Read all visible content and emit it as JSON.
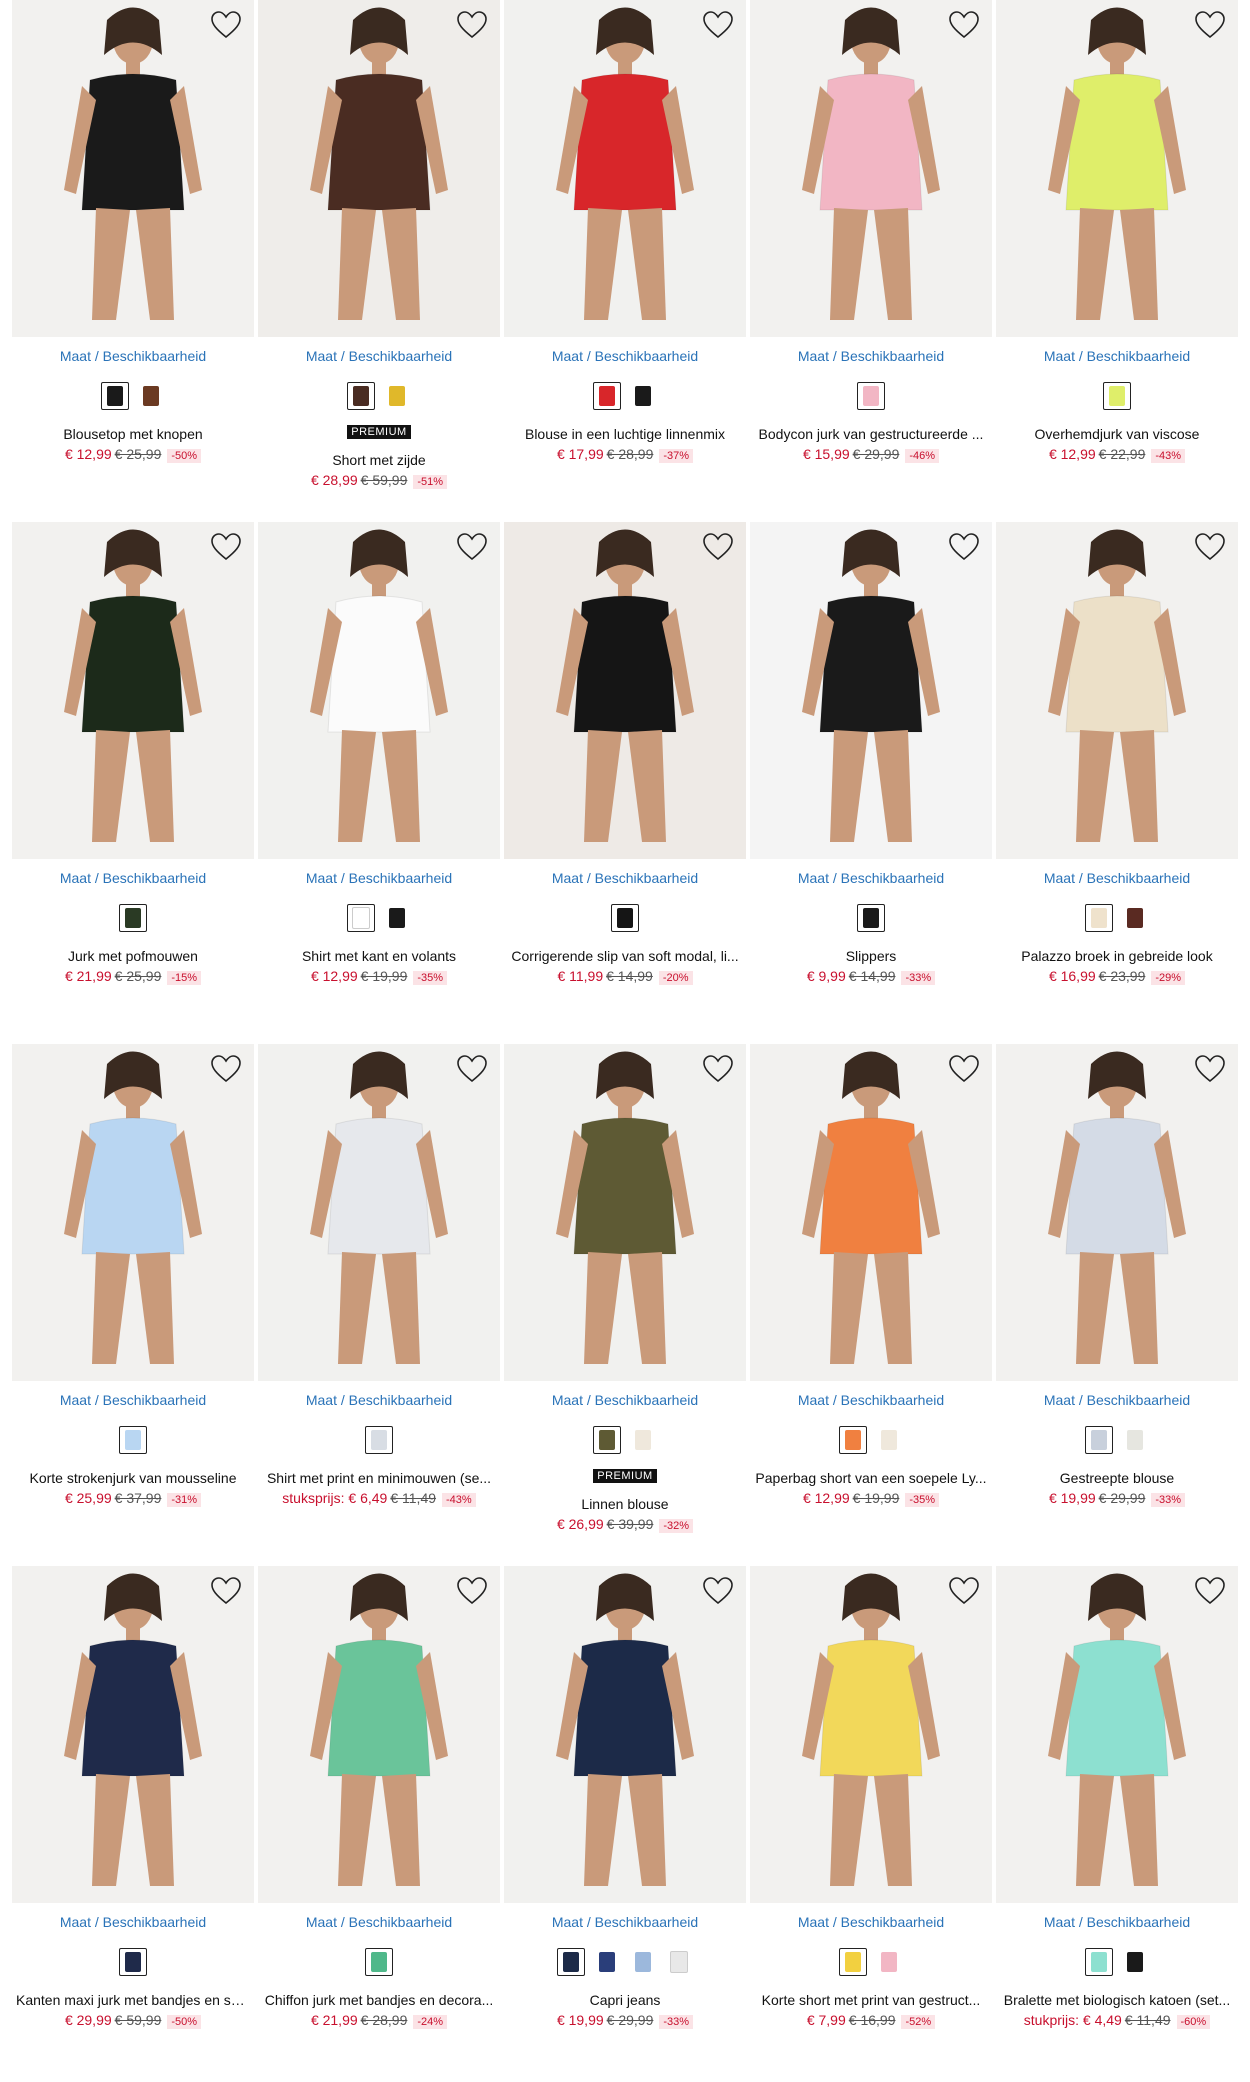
{
  "size_link": "Maat / Beschikbaarheid",
  "premium_label": "PREMIUM",
  "colors": {
    "price": "#c8102e",
    "link": "#2a73b8",
    "discount_bg": "#fbe3e6"
  },
  "products": [
    {
      "title": "Blousetop met knopen",
      "price": "€ 12,99",
      "was": "€ 25,99",
      "discount": "-50%",
      "premium": false,
      "swatches": [
        "#1a1a1a",
        "#6b3a22"
      ],
      "garment": "#1a1a1a",
      "bg": "#f2f1ef"
    },
    {
      "title": "Short met zijde",
      "price": "€ 28,99",
      "was": "€ 59,99",
      "discount": "-51%",
      "premium": true,
      "swatches": [
        "#4a2c22",
        "#e0b82a"
      ],
      "garment": "#4a2c22",
      "bg": "#efedea"
    },
    {
      "title": "Blouse in een luchtige linnenmix",
      "price": "€ 17,99",
      "was": "€ 28,99",
      "discount": "-37%",
      "premium": false,
      "swatches": [
        "#d8262a",
        "#1a1a1a"
      ],
      "garment": "#d8262a",
      "bg": "#f1f1ef"
    },
    {
      "title": "Bodycon jurk van gestructureerde ...",
      "price": "€ 15,99",
      "was": "€ 29,99",
      "discount": "-46%",
      "premium": false,
      "swatches": [
        "#f2b6c4"
      ],
      "garment": "#f2b6c4",
      "bg": "#f2f1ef"
    },
    {
      "title": "Overhemdjurk van viscose",
      "price": "€ 12,99",
      "was": "€ 22,99",
      "discount": "-43%",
      "premium": false,
      "swatches": [
        "#dfee6a"
      ],
      "garment": "#dfee6a",
      "bg": "#f2f1ef"
    },
    {
      "title": "Jurk met pofmouwen",
      "price": "€ 21,99",
      "was": "€ 25,99",
      "discount": "-15%",
      "premium": false,
      "swatches": [
        "#2a3a24"
      ],
      "garment": "#1c2a1a",
      "bg": "#f2f1ef"
    },
    {
      "title": "Shirt met kant en volants",
      "price": "€ 12,99",
      "was": "€ 19,99",
      "discount": "-35%",
      "premium": false,
      "swatches": [
        "#ffffff",
        "#1a1a1a"
      ],
      "garment": "#fbfbfb",
      "bg": "#f1f1ef"
    },
    {
      "title": "Corrigerende slip van soft modal, li...",
      "price": "€ 11,99",
      "was": "€ 14,99",
      "discount": "-20%",
      "premium": false,
      "swatches": [
        "#151515"
      ],
      "garment": "#151515",
      "bg": "#eeeae6"
    },
    {
      "title": "Slippers",
      "price": "€ 9,99",
      "was": "€ 14,99",
      "discount": "-33%",
      "premium": false,
      "swatches": [
        "#1a1a1a"
      ],
      "garment": "#1a1a1a",
      "bg": "#f4f4f4"
    },
    {
      "title": "Palazzo broek in gebreide look",
      "price": "€ 16,99",
      "was": "€ 23,99",
      "discount": "-29%",
      "premium": false,
      "swatches": [
        "#efe2cc",
        "#5a2a22"
      ],
      "garment": "#ece0c8",
      "bg": "#f2f1ef"
    },
    {
      "title": "Korte strokenjurk van mousseline",
      "price": "€ 25,99",
      "was": "€ 37,99",
      "discount": "-31%",
      "premium": false,
      "swatches": [
        "#b9d6f2"
      ],
      "garment": "#b9d6f2",
      "bg": "#f2f1ef"
    },
    {
      "title": "Shirt met print en minimouwen (se...",
      "price": "stuksprijs: € 6,49",
      "was": "€ 11,49",
      "discount": "-43%",
      "premium": false,
      "swatches": [
        "#d8dde4"
      ],
      "garment": "#e6e8ec",
      "bg": "#f1f1ef"
    },
    {
      "title": "Linnen blouse",
      "price": "€ 26,99",
      "was": "€ 39,99",
      "discount": "-32%",
      "premium": true,
      "swatches": [
        "#5e5a34",
        "#efe8dc"
      ],
      "garment": "#5e5a34",
      "bg": "#f1f1ef"
    },
    {
      "title": "Paperbag short van een soepele Ly...",
      "price": "€ 12,99",
      "was": "€ 19,99",
      "discount": "-35%",
      "premium": false,
      "swatches": [
        "#f08040",
        "#efe8dc"
      ],
      "garment": "#f08040",
      "bg": "#f2f1ef"
    },
    {
      "title": "Gestreepte blouse",
      "price": "€ 19,99",
      "was": "€ 29,99",
      "discount": "-33%",
      "premium": false,
      "swatches": [
        "#c8d0dc",
        "#e6e6e0"
      ],
      "garment": "#d4dbe6",
      "bg": "#f2f1ef"
    },
    {
      "title": "Kanten maxi jurk met bandjes en sa...",
      "price": "€ 29,99",
      "was": "€ 59,99",
      "discount": "-50%",
      "premium": false,
      "swatches": [
        "#1f2a4a"
      ],
      "garment": "#1f2a4a",
      "bg": "#f2f1ef"
    },
    {
      "title": "Chiffon jurk met bandjes en decora...",
      "price": "€ 21,99",
      "was": "€ 28,99",
      "discount": "-24%",
      "premium": false,
      "swatches": [
        "#4fb88a"
      ],
      "garment": "#6ac49a",
      "bg": "#f2f1ef"
    },
    {
      "title": "Capri jeans",
      "price": "€ 19,99",
      "was": "€ 29,99",
      "discount": "-33%",
      "premium": false,
      "swatches": [
        "#1c2a48",
        "#2a3e7a",
        "#9cb8dc",
        "#e8e8e8"
      ],
      "garment": "#1c2a48",
      "bg": "#f1f1ef"
    },
    {
      "title": "Korte short met print van gestruct...",
      "price": "€ 7,99",
      "was": "€ 16,99",
      "discount": "-52%",
      "premium": false,
      "swatches": [
        "#f2d040",
        "#f2b6c4"
      ],
      "garment": "#f2d85a",
      "bg": "#f2f1ef"
    },
    {
      "title": "Bralette met biologisch katoen (set...",
      "price": "stukprijs: € 4,49",
      "was": "€ 11,49",
      "discount": "-60%",
      "premium": false,
      "swatches": [
        "#8de0d0",
        "#1a1a1a"
      ],
      "garment": "#8de0d0",
      "bg": "#f2f1ef"
    }
  ]
}
